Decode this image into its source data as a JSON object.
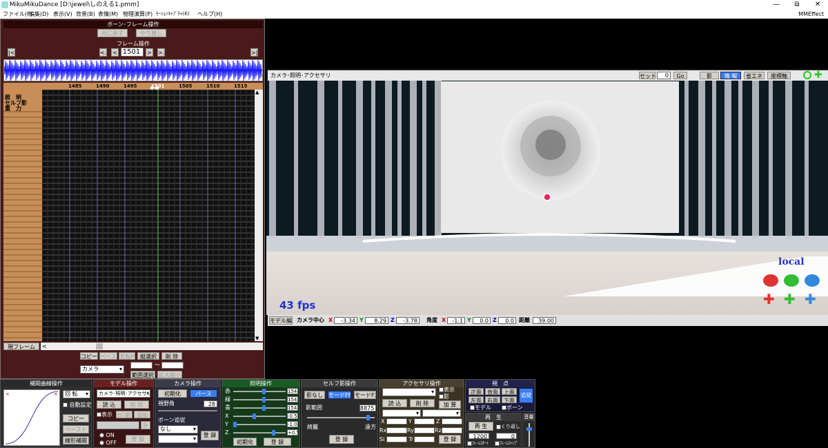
{
  "window": {
    "title": "MikuMikuDance [D:\\jewel\\しのえる1.pmm]",
    "minimize": "—",
    "restore": "⧉",
    "close": "✕"
  },
  "menu": {
    "items": [
      "ファイル(F)",
      "編集(D)",
      "表示(V)",
      "背景(B)",
      "表情(M)",
      "物理演算(P)",
      "ﾓｰｼｮﾝｷｬﾌﾟﾁｬ(K)",
      "ヘルプ(H)"
    ],
    "mmeffect": "MMEffect"
  },
  "bone_frame": {
    "header": "ボーン･フレーム操作",
    "undo": "元に戻す",
    "redo": "やり直し"
  },
  "frame_ops": {
    "header": "フレーム操作",
    "first": "|<",
    "prev_key": "<.",
    "prev": "<",
    "frame": "1501",
    "next": ">",
    "next_key": ">.",
    "last": ">|"
  },
  "timeline": {
    "ticks": [
      "1485",
      "1490",
      "1495",
      "1501",
      "1505",
      "1510",
      "1515"
    ],
    "tracks": [
      "カメラ",
      "照　明",
      "セルフ影",
      "重　力"
    ],
    "current_frame_button": "現フレーム",
    "scroll_left": "<",
    "scroll_up": "▲",
    "scroll_down": "▼"
  },
  "edit_ops": {
    "copy": "コピー",
    "paste": "ペースト",
    "reverse_paste": "反転P",
    "vertical_select": "縦選択",
    "delete": "削 除",
    "target": "カメラ",
    "range_select": "範囲選択",
    "expand_shrink": "拡大縮小",
    "tilde": "～"
  },
  "interpolation": {
    "header": "補間曲線操作",
    "select": "回 転",
    "auto_set": "自動設定",
    "copy": "コピー",
    "paste": "ペースト",
    "linear": "線形補間"
  },
  "model_ops": {
    "header": "モデル操作",
    "model": "カメラ･照明･アクセサリ",
    "load": "読 込",
    "delete": "削 除",
    "show": "表示",
    "self_shadow": "ｾﾙﾌ影",
    "add": "追加",
    "outer": "外",
    "on": "ON",
    "off": "OFF",
    "register": "登 録"
  },
  "camera_ops": {
    "header": "カメラ操作",
    "reset": "初期化",
    "perspective": "パース",
    "fov_label": "視野角",
    "fov": "28",
    "bone_follow": "ボーン追従",
    "follow": "なし",
    "register": "登 録"
  },
  "light_ops": {
    "header": "照明操作",
    "rows": [
      {
        "label": "赤",
        "value": "154"
      },
      {
        "label": "緑",
        "value": "154"
      },
      {
        "label": "青",
        "value": "154"
      },
      {
        "label": "X",
        "value": "-0.5"
      },
      {
        "label": "Y",
        "value": "-1.0"
      },
      {
        "label": "Z",
        "value": "+0.5"
      }
    ],
    "reset": "初期化",
    "register": "登 録"
  },
  "selfshadow_ops": {
    "header": "セルフ影操作",
    "none": "影なし",
    "mode1": "モードFF1",
    "mode2": "モードF2",
    "range_label": "影範囲",
    "range": "8875",
    "near": "綺麗",
    "far": "遠方",
    "register": "登 録"
  },
  "accessory_ops": {
    "header": "アクセサリ操作",
    "show": "表示",
    "shadow": "影",
    "load": "読 込",
    "delete": "削 除",
    "add": "加 算",
    "fields": [
      "X",
      "Y",
      "Z",
      "Rx",
      "Ry",
      "Rz",
      "Si",
      "Tr"
    ],
    "register": "登 録"
  },
  "viewpoint": {
    "header": "視　点",
    "front": "正面",
    "back": "背面",
    "top": "上面",
    "left": "左面",
    "right": "右面",
    "bottom": "下面",
    "follow": "追従",
    "model": "モデル",
    "bone": "ボーン"
  },
  "playback": {
    "header": "再　生",
    "play": "再 生",
    "repeat": "くり返し",
    "from": "1200",
    "to": "0",
    "frame_start": "ﾌﾚｰﾑｽﾀｰﾄ",
    "frame_stop": "ﾌﾚｰﾑｽﾄｯﾌﾟ"
  },
  "volume": {
    "header": "音量"
  },
  "viewport": {
    "header": "カメラ･照明･アクセサリ",
    "set": "セット",
    "set_value": "0",
    "go": "Go",
    "shadow": "影",
    "info": "情 報",
    "power_save": "省エネ",
    "axis": "座標軸",
    "fps": "43 fps",
    "local": "local",
    "mode": "モデル編",
    "center_label": "カメラ中心",
    "cx": "-3.34",
    "cy": "8.29",
    "cz": "-3.78",
    "angle_label": "角度",
    "ax": "-1.1",
    "ay": "0.0",
    "az": "0.0",
    "dist_label": "距離",
    "dist": "39.00"
  },
  "colors": {
    "accent": "#3a7ef0",
    "panel": "#4a1a1a",
    "timeline_track": "#c88e5a"
  }
}
